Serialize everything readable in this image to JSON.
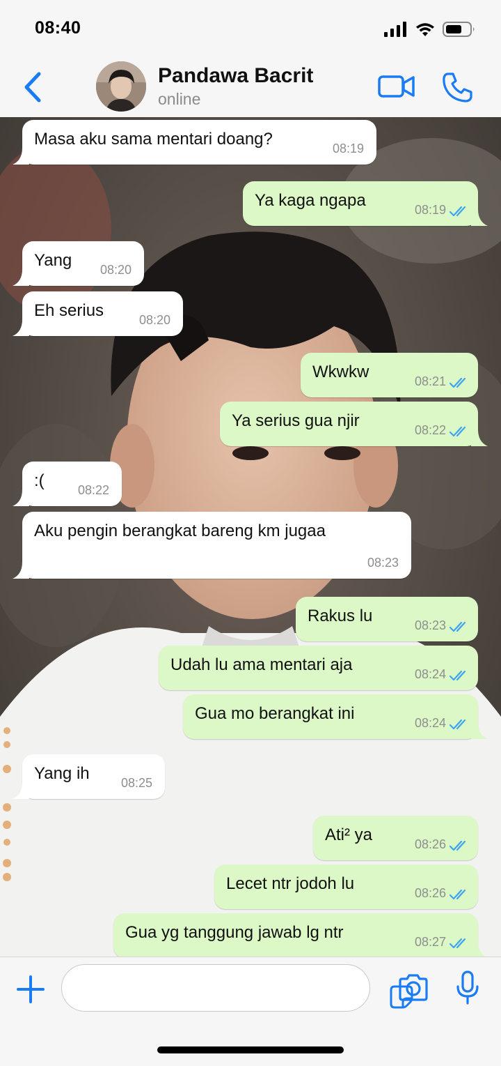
{
  "status": {
    "time": "08:40"
  },
  "header": {
    "name": "Pandawa Bacrit",
    "status": "online"
  },
  "colors": {
    "accent": "#1a7cf5",
    "outgoing_bubble": "#dcf8c6",
    "incoming_bubble": "#ffffff",
    "read_ticks": "#3ca4f4"
  },
  "messages": [
    {
      "dir": "in",
      "text": "Masa aku sama mentari doang?",
      "time": "08:19"
    },
    {
      "dir": "out",
      "text": "Ya kaga ngapa",
      "time": "08:19"
    },
    {
      "dir": "in",
      "text": "Yang",
      "time": "08:20"
    },
    {
      "dir": "in",
      "text": "Eh serius",
      "time": "08:20"
    },
    {
      "dir": "out",
      "text": "Wkwkw",
      "time": "08:21"
    },
    {
      "dir": "out",
      "text": "Ya serius gua njir",
      "time": "08:22"
    },
    {
      "dir": "in",
      "text": ":(",
      "time": "08:22"
    },
    {
      "dir": "in",
      "text": "Aku pengin berangkat bareng km jugaa",
      "time": "08:23"
    },
    {
      "dir": "out",
      "text": "Rakus lu",
      "time": "08:23"
    },
    {
      "dir": "out",
      "text": "Udah lu ama mentari aja",
      "time": "08:24"
    },
    {
      "dir": "out",
      "text": "Gua mo berangkat ini",
      "time": "08:24"
    },
    {
      "dir": "in",
      "text": "Yang ih",
      "time": "08:25"
    },
    {
      "dir": "out",
      "text": "Ati² ya",
      "time": "08:26"
    },
    {
      "dir": "out",
      "text": "Lecet ntr jodoh lu",
      "time": "08:26"
    },
    {
      "dir": "out",
      "text": "Gua yg tanggung jawab lg ntr",
      "time": "08:27"
    }
  ],
  "icons": {
    "back": "chevron-left-icon",
    "video": "video-camera-icon",
    "call": "phone-icon",
    "attach": "plus-icon",
    "sticker": "sticker-icon",
    "camera": "camera-icon",
    "mic": "microphone-icon"
  }
}
